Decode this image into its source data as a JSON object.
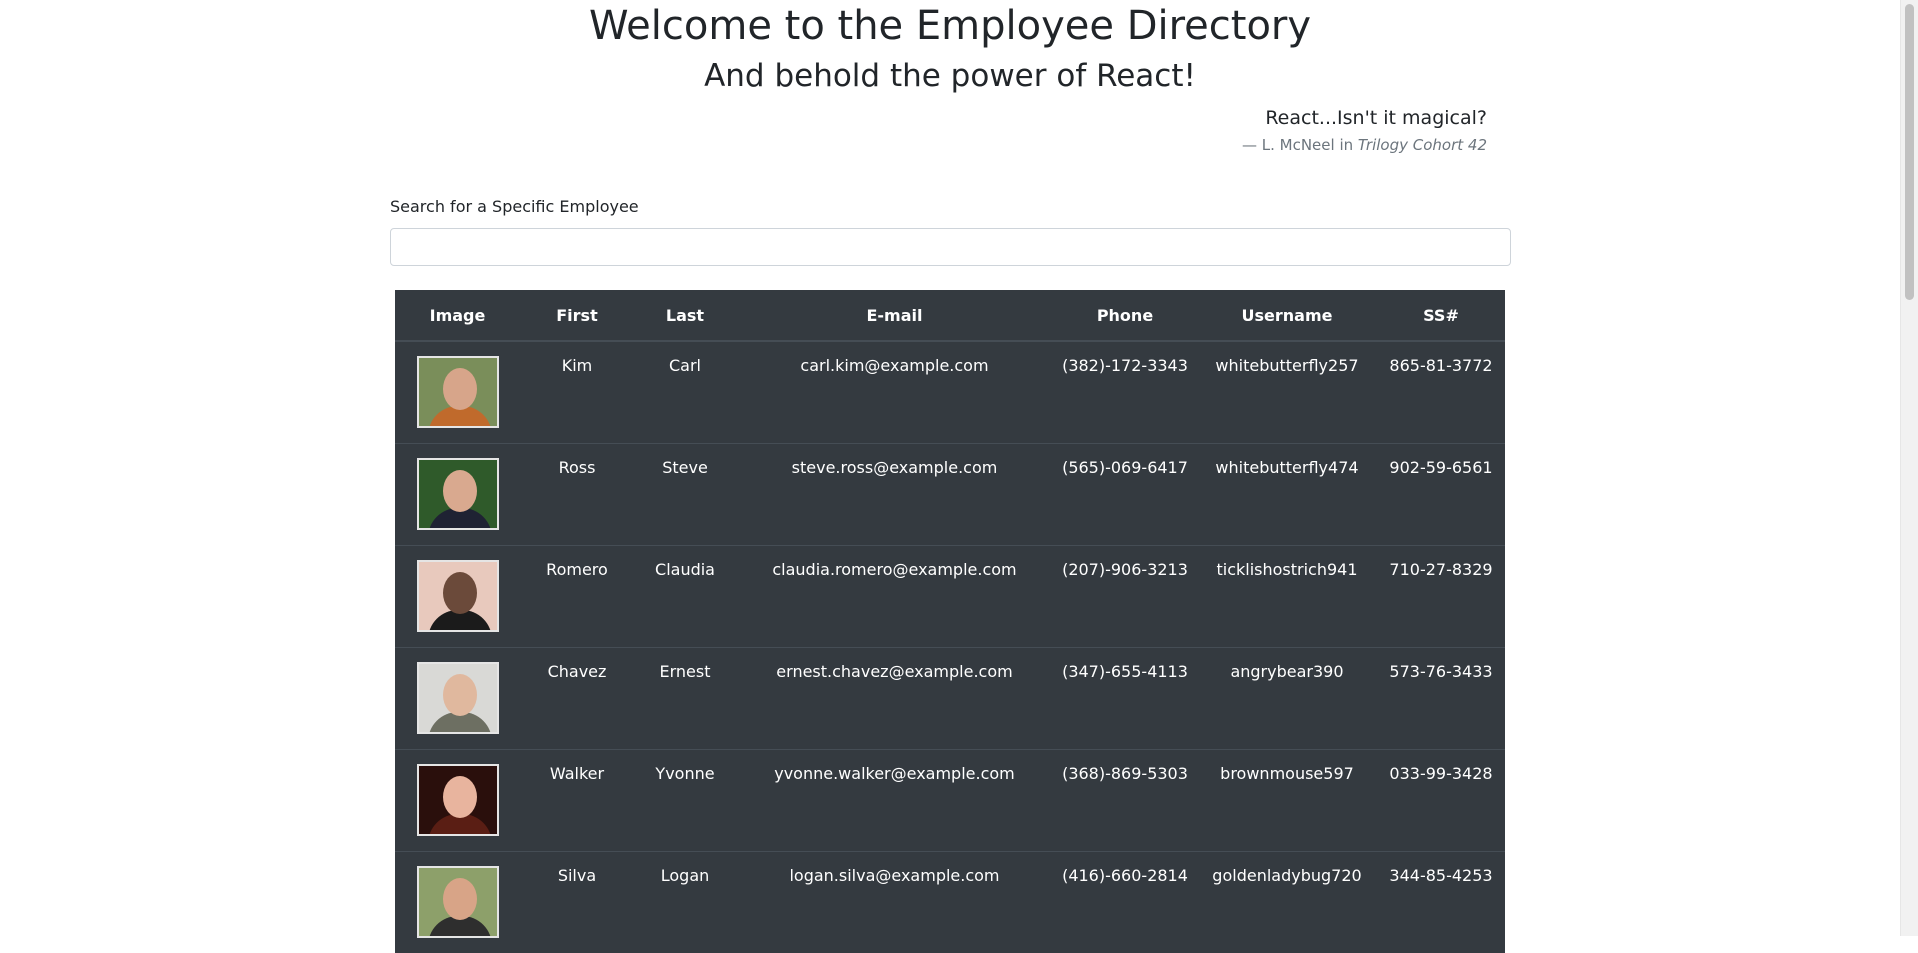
{
  "header": {
    "title": "Welcome to the Employee Directory",
    "subtitle": "And behold the power of React!"
  },
  "quote": {
    "text": "React...Isn't it magical?",
    "attribution": "— L. McNeel in",
    "source": "Trilogy Cohort 42"
  },
  "search": {
    "label": "Search for a Specific Employee",
    "value": "",
    "placeholder": ""
  },
  "table": {
    "columns": [
      "Image",
      "First",
      "Last",
      "E-mail",
      "Phone",
      "Username",
      "SS#"
    ],
    "rows": [
      {
        "first": "Kim",
        "last": "Carl",
        "email": "carl.kim@example.com",
        "phone": "(382)-172-3343",
        "username": "whitebutterfly257",
        "ssn": "865-81-3772",
        "photo": {
          "bg": "#7a8e5a",
          "skin": "#d7a58a",
          "shirt": "#c06a2c"
        }
      },
      {
        "first": "Ross",
        "last": "Steve",
        "email": "steve.ross@example.com",
        "phone": "(565)-069-6417",
        "username": "whitebutterfly474",
        "ssn": "902-59-6561",
        "photo": {
          "bg": "#2f5a2a",
          "skin": "#d9a98f",
          "shirt": "#1f2233"
        }
      },
      {
        "first": "Romero",
        "last": "Claudia",
        "email": "claudia.romero@example.com",
        "phone": "(207)-906-3213",
        "username": "ticklishostrich941",
        "ssn": "710-27-8329",
        "photo": {
          "bg": "#e8c9bd",
          "skin": "#6b4a3a",
          "shirt": "#1b1b1b"
        }
      },
      {
        "first": "Chavez",
        "last": "Ernest",
        "email": "ernest.chavez@example.com",
        "phone": "(347)-655-4113",
        "username": "angrybear390",
        "ssn": "573-76-3433",
        "photo": {
          "bg": "#d9d9d6",
          "skin": "#e0b89e",
          "shirt": "#6d6f62"
        }
      },
      {
        "first": "Walker",
        "last": "Yvonne",
        "email": "yvonne.walker@example.com",
        "phone": "(368)-869-5303",
        "username": "brownmouse597",
        "ssn": "033-99-3428",
        "photo": {
          "bg": "#2a0f0c",
          "skin": "#e8b49e",
          "shirt": "#5a1e14"
        }
      },
      {
        "first": "Silva",
        "last": "Logan",
        "email": "logan.silva@example.com",
        "phone": "(416)-660-2814",
        "username": "goldenladybug720",
        "ssn": "344-85-4253",
        "photo": {
          "bg": "#8da06a",
          "skin": "#d8a487",
          "shirt": "#2e2e2e"
        }
      }
    ]
  }
}
